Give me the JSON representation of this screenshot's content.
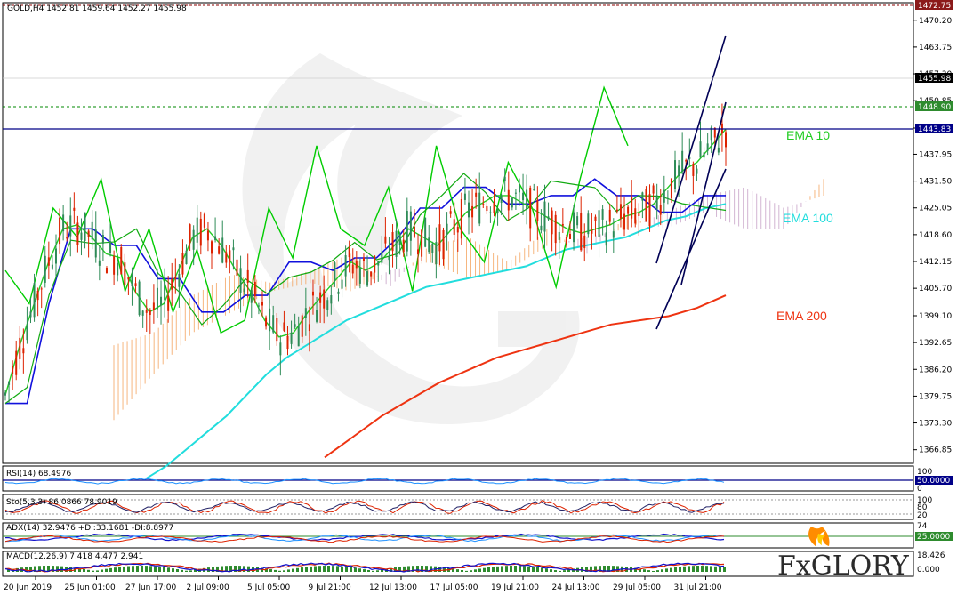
{
  "header": {
    "symbol_line": "GOLD,H4  1452.81 1459.64 1452.27 1455.98"
  },
  "colors": {
    "ema10": "#22cc22",
    "ema100": "#22dddd",
    "ema200": "#ee3311",
    "kijun": "#1111dd",
    "tenkan": "#11aa11",
    "chikou": "#00cc00",
    "cloud_up": "#f4a460",
    "cloud_down": "#c8a2c8",
    "candle_up": "#2e8b57",
    "candle_down": "#dd2200",
    "level_blue": "#000088",
    "level_green": "#008800"
  },
  "price_axis": {
    "ticks": [
      "1470.20",
      "1463.75",
      "1457.30",
      "1450.85",
      "1444.25",
      "1437.95",
      "1431.50",
      "1425.05",
      "1418.60",
      "1412.15",
      "1405.70",
      "1399.10",
      "1392.65",
      "1386.20",
      "1379.75",
      "1373.30",
      "1366.85"
    ],
    "badges": {
      "top": "1472.75",
      "close": "1455.98",
      "level1": "1448.90",
      "level2": "1443.83"
    }
  },
  "time_axis": {
    "ticks": [
      "20 Jun 2019",
      "25 Jun 01:00",
      "27 Jun 17:00",
      "2 Jul 09:00",
      "5 Jul 05:00",
      "9 Jul 21:00",
      "12 Jul 13:00",
      "17 Jul 05:00",
      "19 Jul 21:00",
      "24 Jul 13:00",
      "29 Jul 05:00",
      "31 Jul 21:00"
    ]
  },
  "labels": {
    "ema10": "EMA 10",
    "ema100": "EMA 100",
    "ema200": "EMA 200"
  },
  "indicators": {
    "rsi": {
      "title": "RSI(14) 68.4976",
      "levels": [
        "100",
        "50.0000",
        "0"
      ]
    },
    "stoch": {
      "title": "Sto(5,3,3) 86.0866 78.9019",
      "levels": [
        "100",
        "80",
        "20"
      ]
    },
    "adx": {
      "title": "ADX(14) 32.9476 +DI:33.1681 -DI:8.8977",
      "levels": [
        "74",
        "25.0000"
      ]
    },
    "macd": {
      "title": "MACD(12,26,9) 7.418 4.477 2.941",
      "levels": [
        "18.426",
        "0.000"
      ]
    }
  },
  "logo": {
    "text": "FxGLORY"
  },
  "chart_data": {
    "type": "candlestick",
    "symbol": "GOLD",
    "timeframe": "H4",
    "ohlc_last": {
      "open": 1452.81,
      "high": 1459.64,
      "low": 1452.27,
      "close": 1455.98
    },
    "ylim": [
      1364,
      1474
    ],
    "horizontal_levels": [
      1448.9,
      1443.83
    ],
    "series": [
      {
        "name": "EMA 10",
        "values": [
          1380,
          1392,
          1402,
          1412,
          1420,
          1421,
          1418,
          1414,
          1413,
          1405,
          1400,
          1402,
          1410,
          1418,
          1420,
          1416,
          1410,
          1405,
          1398,
          1394,
          1395,
          1400,
          1404,
          1408,
          1412,
          1410,
          1412,
          1416,
          1420,
          1418,
          1416,
          1420,
          1424,
          1426,
          1428,
          1428,
          1426,
          1424,
          1422,
          1420,
          1419,
          1420,
          1421,
          1423,
          1424,
          1426,
          1430,
          1434,
          1436,
          1440,
          1444
        ]
      },
      {
        "name": "EMA 100",
        "values": [
          1360,
          1363,
          1367,
          1371,
          1375,
          1380,
          1385,
          1389,
          1392,
          1395,
          1398,
          1400,
          1402,
          1404,
          1406,
          1407,
          1408,
          1409,
          1410,
          1411,
          1413,
          1415,
          1416,
          1417,
          1418,
          1420,
          1422,
          1423,
          1425,
          1426
        ]
      },
      {
        "name": "EMA 200",
        "values": [
          1365,
          1370,
          1375,
          1379,
          1383,
          1386,
          1389,
          1391,
          1393,
          1395,
          1397,
          1398,
          1399,
          1401,
          1404
        ]
      }
    ]
  }
}
